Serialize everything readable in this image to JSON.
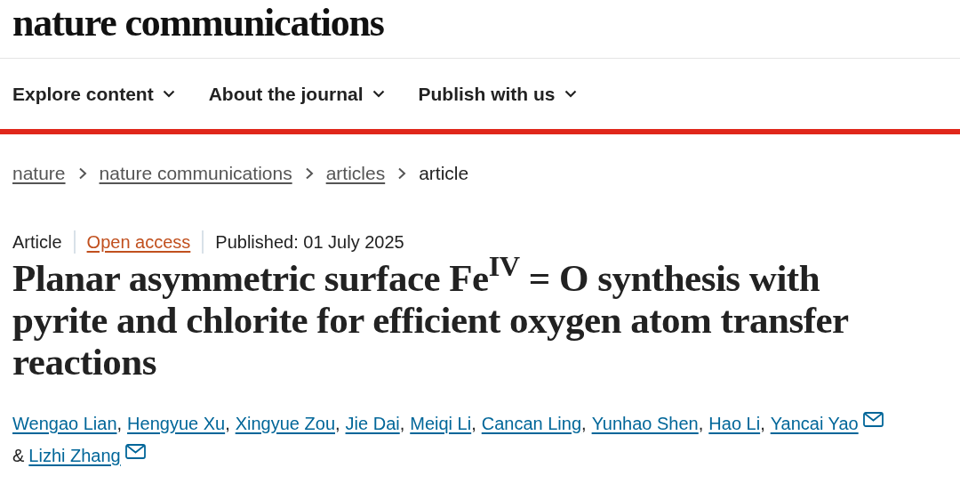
{
  "logo": "nature communications",
  "nav": [
    {
      "label": "Explore content"
    },
    {
      "label": "About the journal"
    },
    {
      "label": "Publish with us"
    }
  ],
  "breadcrumbs": [
    {
      "label": "nature",
      "current": false
    },
    {
      "label": "nature communications",
      "current": false
    },
    {
      "label": "articles",
      "current": false
    },
    {
      "label": "article",
      "current": true
    }
  ],
  "meta": {
    "type": "Article",
    "access": "Open access",
    "published": "Published: 01 July 2025"
  },
  "title": "Planar asymmetric surface Fe$^{IV}$ = O synthesis with pyrite and chlorite for efficient oxygen atom transfer reactions",
  "authors": [
    {
      "name": "Wengao Lian",
      "suffix": ",",
      "email": false
    },
    {
      "name": "Hengyue Xu",
      "suffix": ",",
      "email": false
    },
    {
      "name": "Xingyue Zou",
      "suffix": ",",
      "email": false
    },
    {
      "name": "Jie Dai",
      "suffix": ",",
      "email": false
    },
    {
      "name": "Meiqi Li",
      "suffix": ",",
      "email": false
    },
    {
      "name": "Cancan Ling",
      "suffix": ",",
      "email": false
    },
    {
      "name": "Yunhao Shen",
      "suffix": ",",
      "email": false
    },
    {
      "name": "Hao Li",
      "suffix": ",",
      "email": false
    },
    {
      "name": "Yancai Yao",
      "email": true
    },
    {
      "before": "&",
      "name": "Lizhi Zhang",
      "email": true
    }
  ]
}
